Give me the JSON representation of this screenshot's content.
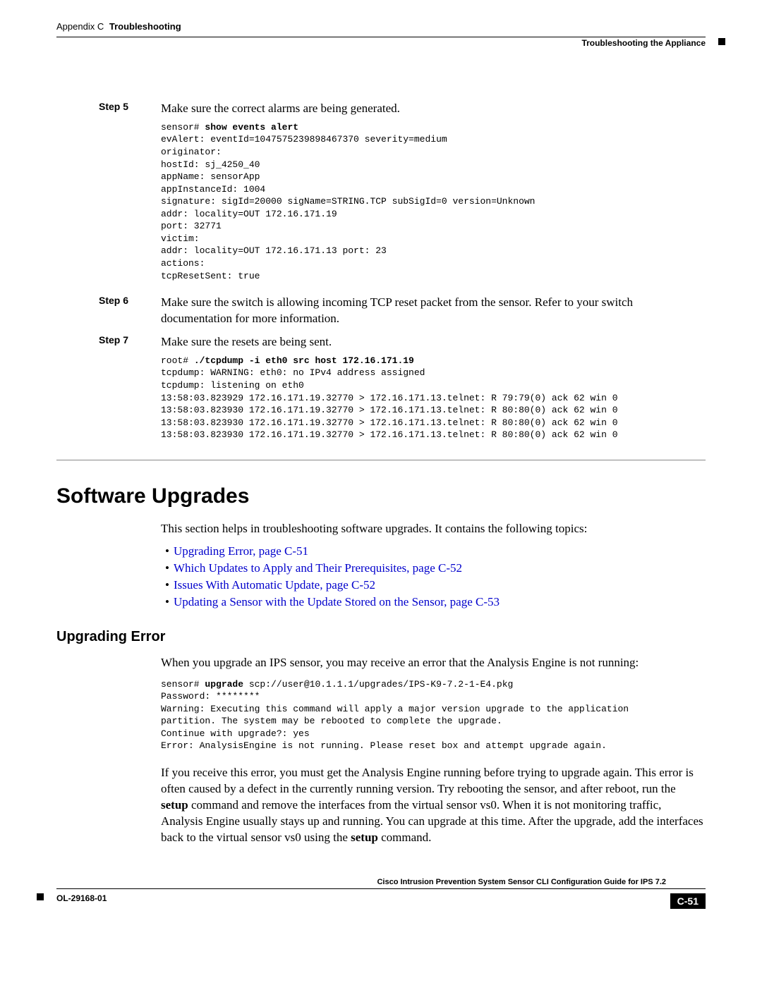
{
  "header": {
    "appendix": "Appendix C",
    "title": "Troubleshooting",
    "right": "Troubleshooting the Appliance"
  },
  "steps": {
    "s5_label": "Step 5",
    "s5_text": "Make sure the correct alarms are being generated.",
    "s5_code_prompt": "sensor# ",
    "s5_code_cmd": "show events alert",
    "s5_code_body": "evAlert: eventId=1047575239898467370 severity=medium\noriginator:\nhostId: sj_4250_40\nappName: sensorApp\nappInstanceId: 1004\nsignature: sigId=20000 sigName=STRING.TCP subSigId=0 version=Unknown\naddr: locality=OUT 172.16.171.19\nport: 32771\nvictim:\naddr: locality=OUT 172.16.171.13 port: 23\nactions:\ntcpResetSent: true",
    "s6_label": "Step 6",
    "s6_text": "Make sure the switch is allowing incoming TCP reset packet from the sensor. Refer to your switch documentation for more information.",
    "s7_label": "Step 7",
    "s7_text": "Make sure the resets are being sent.",
    "s7_code_prompt": "root# ",
    "s7_code_cmd": "./tcpdump -i eth0 src host 172.16.171.19",
    "s7_code_body": "tcpdump: WARNING: eth0: no IPv4 address assigned\ntcpdump: listening on eth0\n13:58:03.823929 172.16.171.19.32770 > 172.16.171.13.telnet: R 79:79(0) ack 62 win 0\n13:58:03.823930 172.16.171.19.32770 > 172.16.171.13.telnet: R 80:80(0) ack 62 win 0\n13:58:03.823930 172.16.171.19.32770 > 172.16.171.13.telnet: R 80:80(0) ack 62 win 0\n13:58:03.823930 172.16.171.19.32770 > 172.16.171.13.telnet: R 80:80(0) ack 62 win 0"
  },
  "section": {
    "title": "Software Upgrades",
    "intro": "This section helps in troubleshooting software upgrades. It contains the following topics:",
    "links": [
      "Upgrading Error, page C-51",
      "Which Updates to Apply and Their Prerequisites, page C-52",
      "Issues With Automatic Update, page C-52",
      "Updating a Sensor with the Update Stored on the Sensor, page C-53"
    ]
  },
  "sub": {
    "title": "Upgrading Error",
    "p1": "When you upgrade an IPS sensor, you may receive an error that the Analysis Engine is not running:",
    "code_prompt": "sensor# ",
    "code_cmd": "upgrade",
    "code_after": " scp://user@10.1.1.1/upgrades/IPS-K9-7.2-1-E4.pkg",
    "code_body": "Password: ********\nWarning: Executing this command will apply a major version upgrade to the application\npartition. The system may be rebooted to complete the upgrade.\nContinue with upgrade?: yes\nError: AnalysisEngine is not running. Please reset box and attempt upgrade again.",
    "p2a": "If you receive this error, you must get the Analysis Engine running before trying to upgrade again. This error is often caused by a defect in the currently running version. Try rebooting the sensor, and after reboot, run the ",
    "p2_cmd1": "setup",
    "p2b": " command and remove the interfaces from the virtual sensor vs0. When it is not monitoring traffic, Analysis Engine usually stays up and running. You can upgrade at this time. After the upgrade, add the interfaces back to the virtual sensor vs0 using the ",
    "p2_cmd2": "setup",
    "p2c": " command."
  },
  "footer": {
    "guide": "Cisco Intrusion Prevention System Sensor CLI Configuration Guide for IPS 7.2",
    "ol": "OL-29168-01",
    "page": "C-51"
  }
}
